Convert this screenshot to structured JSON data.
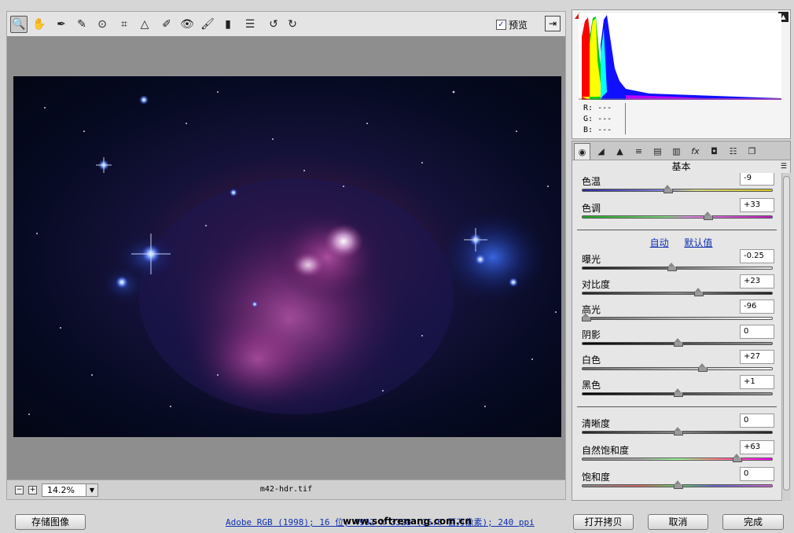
{
  "toolbar": {
    "tools": [
      "zoom-icon",
      "hand-icon",
      "white-balance-icon",
      "color-sampler-icon",
      "targeted-adjust-icon",
      "crop-icon",
      "straighten-icon",
      "spot-removal-icon",
      "red-eye-icon",
      "adjustment-brush-icon",
      "graduated-filter-icon",
      "preferences-icon",
      "rotate-ccw-icon",
      "rotate-cw-icon"
    ],
    "preview_label": "预览",
    "preview_checked": "✓"
  },
  "statusbar": {
    "zoom_value": "14.2%",
    "zoom_minus": "−",
    "zoom_plus": "+",
    "filename": "m42-hdr.tif"
  },
  "histogram": {
    "r_label": "R:",
    "g_label": "G:",
    "b_label": "B:",
    "r_value": "---",
    "g_value": "---",
    "b_value": "---",
    "colors": {
      "red": "#ff0000",
      "yellow": "#ffff00",
      "green": "#00d000",
      "blue": "#1010ff"
    }
  },
  "panel": {
    "title": "基本",
    "menu_icon": "☰"
  },
  "basic": {
    "temp": {
      "label": "色温",
      "value": "-9"
    },
    "tint": {
      "label": "色调",
      "value": "+33"
    },
    "auto": "自动",
    "default": "默认值",
    "exposure": {
      "label": "曝光",
      "value": "-0.25"
    },
    "contrast": {
      "label": "对比度",
      "value": "+23"
    },
    "highlights": {
      "label": "高光",
      "value": "-96"
    },
    "shadows": {
      "label": "阴影",
      "value": "0"
    },
    "whites": {
      "label": "白色",
      "value": "+27"
    },
    "blacks": {
      "label": "黑色",
      "value": "+1"
    },
    "clarity": {
      "label": "清晰度",
      "value": "0"
    },
    "vibrance": {
      "label": "自然饱和度",
      "value": "+63"
    },
    "saturation": {
      "label": "饱和度",
      "value": "0"
    }
  },
  "slider_levels": {
    "temp": 0.45,
    "tint": 0.66,
    "exposure": 0.47,
    "contrast": 0.61,
    "highlights": 0.02,
    "shadows": 0.5,
    "whites": 0.63,
    "blacks": 0.5,
    "clarity": 0.5,
    "vibrance": 0.81,
    "saturation": 0.5
  },
  "footer": {
    "save_label": "存储图像",
    "workflow_link": "Adobe RGB (1998); 16 位; 4992 x 3328 (16.6 百万像素); 240 ppi",
    "watermark": "www.softrenang.com.cn",
    "open_copy": "打开拷贝",
    "cancel": "取消",
    "done": "完成"
  }
}
